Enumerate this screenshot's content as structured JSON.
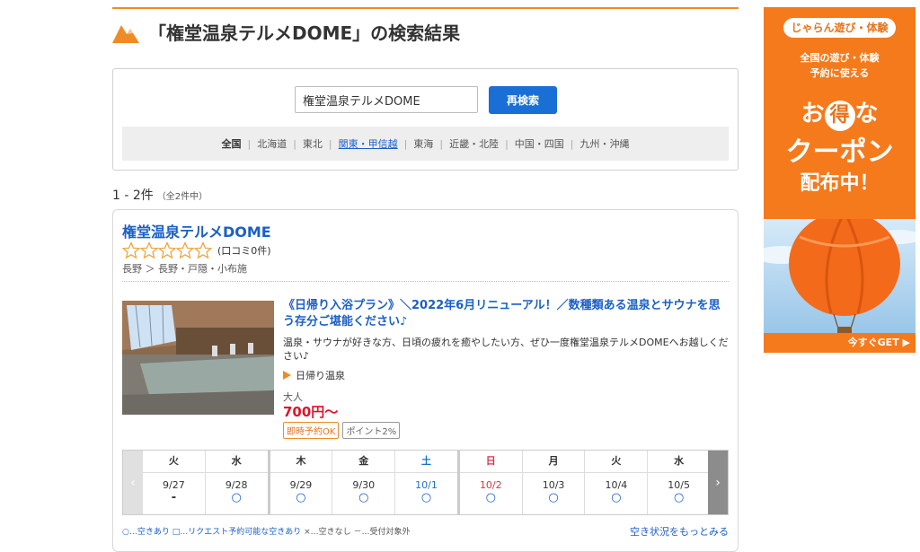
{
  "page": {
    "title": "「権堂温泉テルメDOME」の検索結果"
  },
  "search": {
    "value": "権堂温泉テルメDOME",
    "button_label": "再検索"
  },
  "regions": [
    {
      "label": "全国",
      "state": "active"
    },
    {
      "label": "北海道",
      "state": "normal"
    },
    {
      "label": "東北",
      "state": "normal"
    },
    {
      "label": "関東・甲信越",
      "state": "link"
    },
    {
      "label": "東海",
      "state": "normal"
    },
    {
      "label": "近畿・北陸",
      "state": "normal"
    },
    {
      "label": "中国・四国",
      "state": "normal"
    },
    {
      "label": "九州・沖縄",
      "state": "normal"
    }
  ],
  "results": {
    "count_label": "1 - 2件",
    "total_label": "（全2件中）"
  },
  "hotel": {
    "name": "権堂温泉テルメDOME",
    "rating_stars": 0,
    "review_label": "(口コミ0件)",
    "location": "長野 ＞ 長野・戸隠・小布施"
  },
  "plan": {
    "title": "《日帰り入浴プラン》＼2022年6月リニューアル！／数種類ある温泉とサウナを思う存分ご堪能ください♪",
    "description": "温泉・サウナが好きな方、日頃の疲れを癒やしたい方、ぜひ一度権堂温泉テルメDOMEへお越しください♪",
    "type_label": "日帰り温泉",
    "age_label": "大人",
    "price": "700円〜",
    "badges": [
      {
        "label": "即時予約OK",
        "style": "orange"
      },
      {
        "label": "ポイント2%",
        "style": "gray"
      }
    ]
  },
  "calendar": {
    "prev_label": "‹",
    "next_label": "›",
    "days": [
      {
        "dow": "火",
        "date": "9/27",
        "mark": "-",
        "kind": "weekday"
      },
      {
        "dow": "水",
        "date": "9/28",
        "mark": "○",
        "kind": "weekday"
      },
      {
        "dow": "木",
        "date": "9/29",
        "mark": "○",
        "kind": "weekday",
        "gap": true
      },
      {
        "dow": "金",
        "date": "9/30",
        "mark": "○",
        "kind": "weekday"
      },
      {
        "dow": "土",
        "date": "10/1",
        "mark": "○",
        "kind": "sat"
      },
      {
        "dow": "日",
        "date": "10/2",
        "mark": "○",
        "kind": "sun",
        "gap": true
      },
      {
        "dow": "月",
        "date": "10/3",
        "mark": "○",
        "kind": "weekday"
      },
      {
        "dow": "火",
        "date": "10/4",
        "mark": "○",
        "kind": "weekday"
      },
      {
        "dow": "水",
        "date": "10/5",
        "mark": "○",
        "kind": "weekday"
      }
    ],
    "legend_part1": "○…空きあり",
    "legend_part2": "□…リクエスト予約可能な空きあり",
    "legend_part3": "×…空きなし －…受付対象外",
    "more_link": "空き状況をもっとみる"
  },
  "ad": {
    "brand": "じゃらん遊び・体験",
    "sub_line1": "全国の遊び・体験",
    "sub_line2": "予約に使える",
    "big1_pre": "お",
    "big1_circle": "得",
    "big1_post": "な",
    "big2": "クーポン",
    "big3": "配布中！",
    "cta": "今すぐGET ▶"
  },
  "colors": {
    "accent_orange": "#f08a24",
    "link_blue": "#1a5fc8",
    "price_red": "#e0122a",
    "button_blue": "#1a6fd6"
  }
}
